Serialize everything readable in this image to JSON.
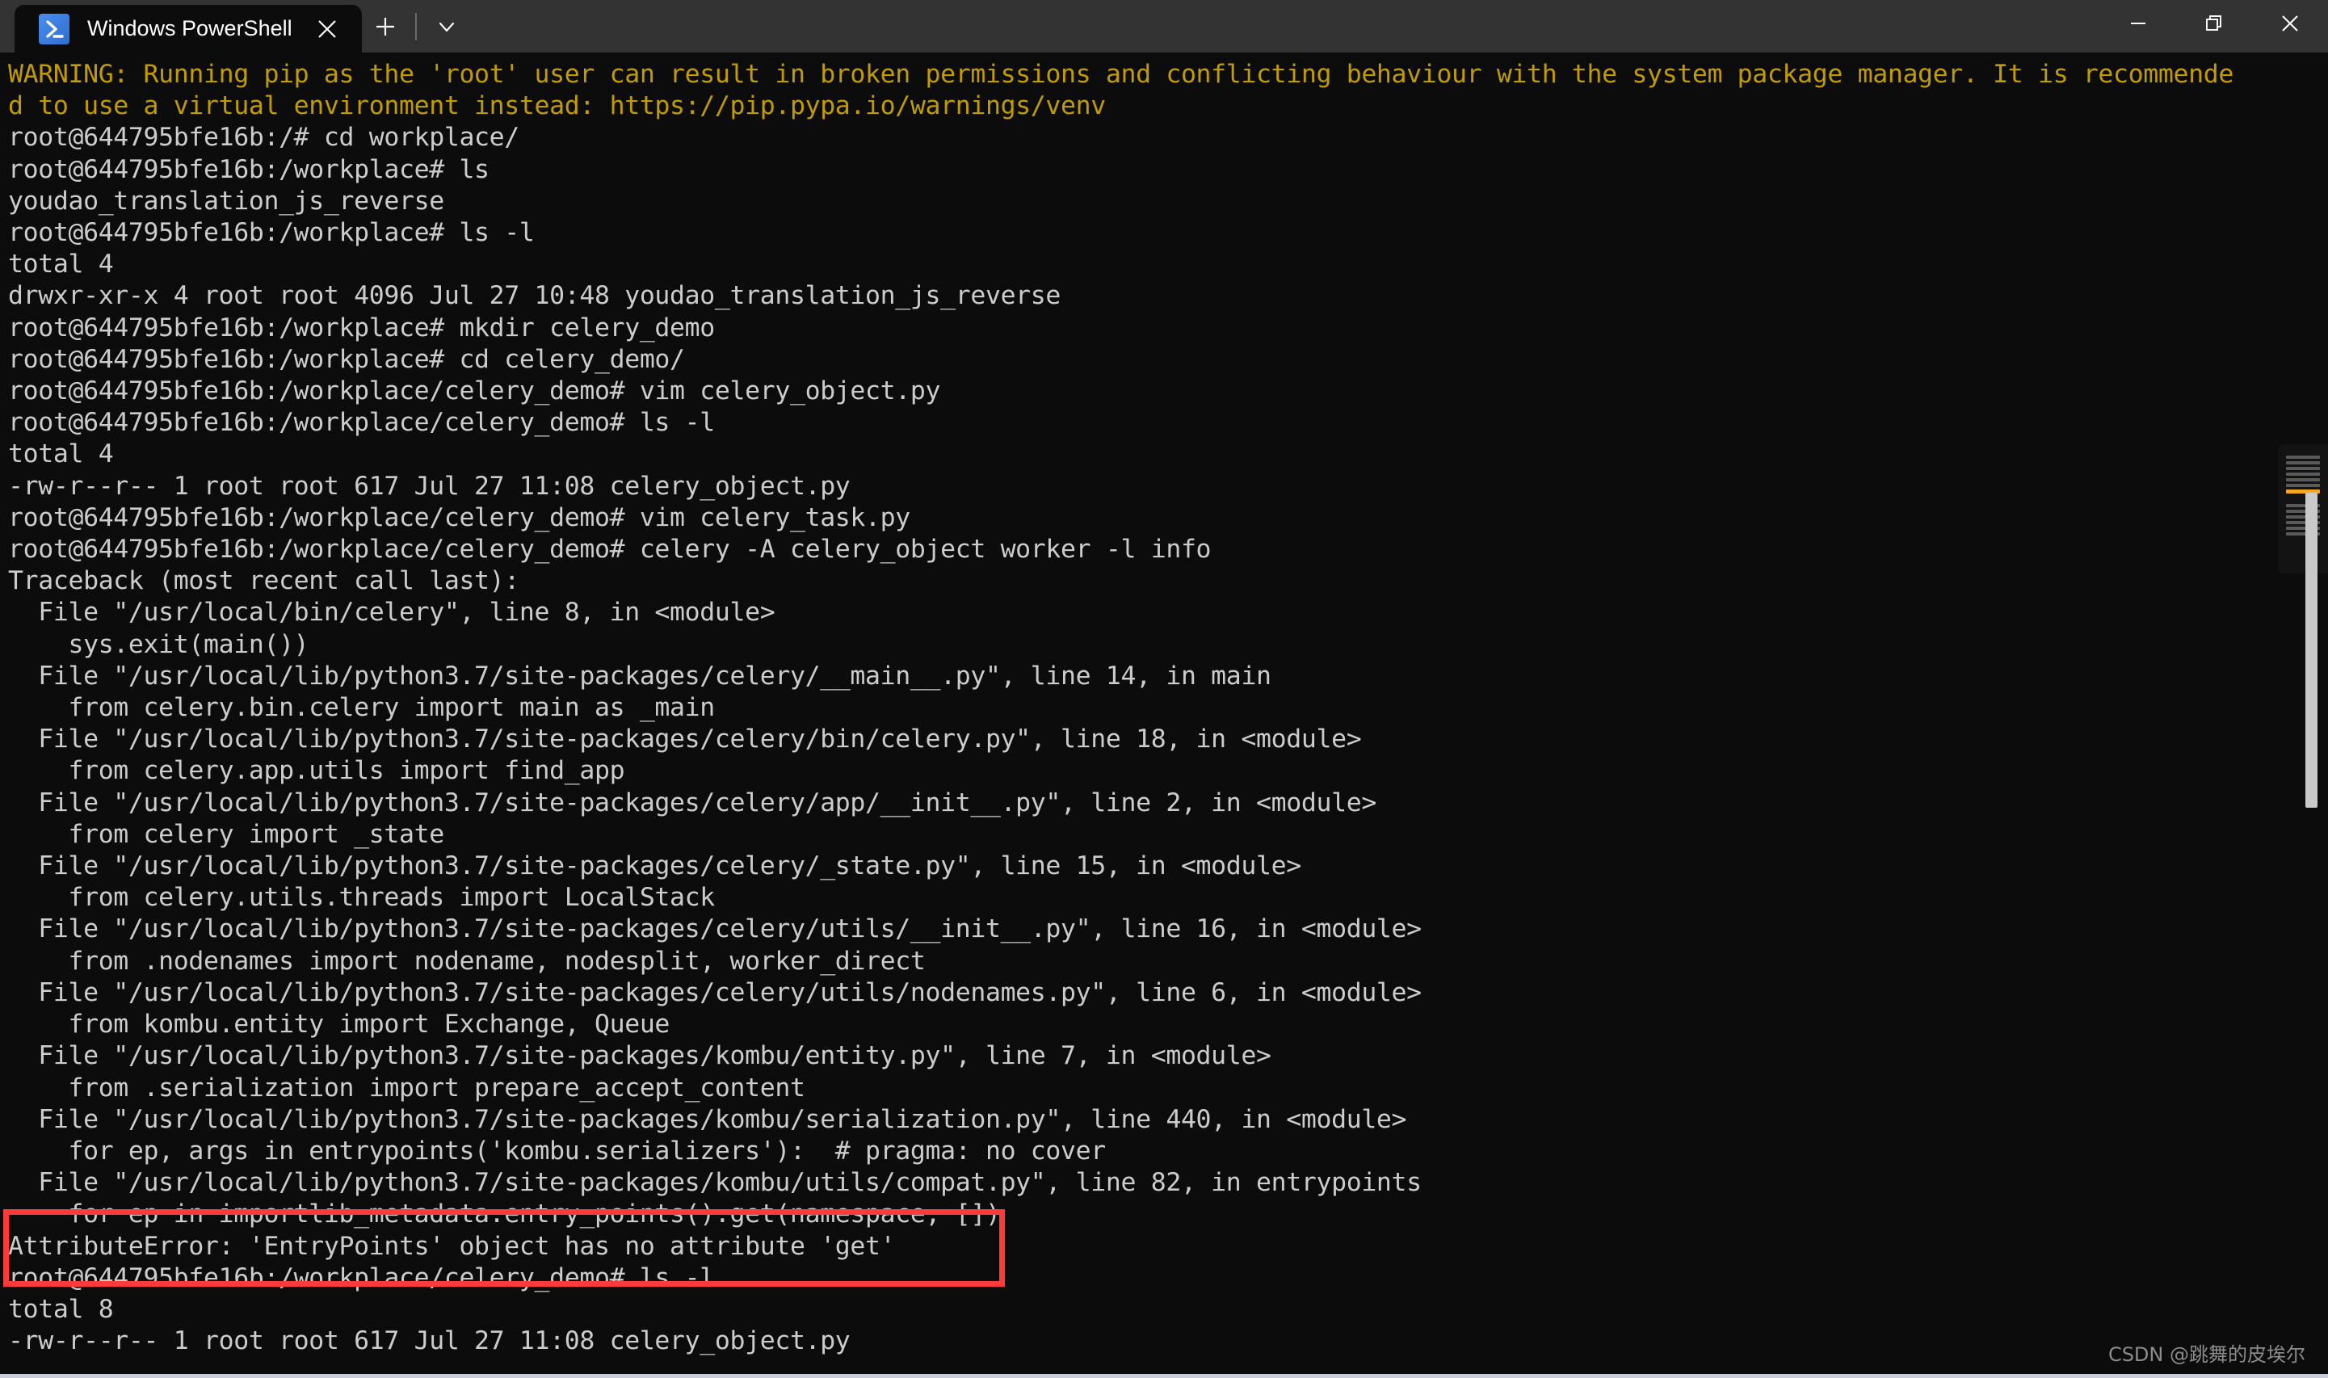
{
  "window": {
    "app_title": "Windows PowerShell",
    "tab_icon": "powershell-icon",
    "close_tab_icon": "close-icon",
    "new_tab_icon": "plus-icon",
    "tab_dropdown_icon": "chevron-down-icon",
    "minimize_icon": "minimize-icon",
    "maximize_icon": "restore-icon",
    "close_icon": "close-icon"
  },
  "terminal": {
    "prompt_host": "root@644795bfe16b",
    "lines": [
      {
        "text": "WARNING: Running pip as the 'root' user can result in broken permissions and conflicting behaviour with the system package manager. It is recommende",
        "style": "warn"
      },
      {
        "text": "d to use a virtual environment instead: https://pip.pypa.io/warnings/venv",
        "style": "warn"
      },
      {
        "text": "root@644795bfe16b:/# cd workplace/",
        "style": "normal"
      },
      {
        "text": "root@644795bfe16b:/workplace# ls",
        "style": "normal"
      },
      {
        "text": "youdao_translation_js_reverse",
        "style": "normal"
      },
      {
        "text": "root@644795bfe16b:/workplace# ls -l",
        "style": "normal"
      },
      {
        "text": "total 4",
        "style": "normal"
      },
      {
        "text": "drwxr-xr-x 4 root root 4096 Jul 27 10:48 youdao_translation_js_reverse",
        "style": "normal"
      },
      {
        "text": "root@644795bfe16b:/workplace# mkdir celery_demo",
        "style": "normal"
      },
      {
        "text": "root@644795bfe16b:/workplace# cd celery_demo/",
        "style": "normal"
      },
      {
        "text": "root@644795bfe16b:/workplace/celery_demo# vim celery_object.py",
        "style": "normal"
      },
      {
        "text": "root@644795bfe16b:/workplace/celery_demo# ls -l",
        "style": "normal"
      },
      {
        "text": "total 4",
        "style": "normal"
      },
      {
        "text": "-rw-r--r-- 1 root root 617 Jul 27 11:08 celery_object.py",
        "style": "normal"
      },
      {
        "text": "root@644795bfe16b:/workplace/celery_demo# vim celery_task.py",
        "style": "normal"
      },
      {
        "text": "root@644795bfe16b:/workplace/celery_demo# celery -A celery_object worker -l info",
        "style": "normal"
      },
      {
        "text": "Traceback (most recent call last):",
        "style": "normal"
      },
      {
        "text": "  File \"/usr/local/bin/celery\", line 8, in <module>",
        "style": "normal"
      },
      {
        "text": "    sys.exit(main())",
        "style": "normal"
      },
      {
        "text": "  File \"/usr/local/lib/python3.7/site-packages/celery/__main__.py\", line 14, in main",
        "style": "normal"
      },
      {
        "text": "    from celery.bin.celery import main as _main",
        "style": "normal"
      },
      {
        "text": "  File \"/usr/local/lib/python3.7/site-packages/celery/bin/celery.py\", line 18, in <module>",
        "style": "normal"
      },
      {
        "text": "    from celery.app.utils import find_app",
        "style": "normal"
      },
      {
        "text": "  File \"/usr/local/lib/python3.7/site-packages/celery/app/__init__.py\", line 2, in <module>",
        "style": "normal"
      },
      {
        "text": "    from celery import _state",
        "style": "normal"
      },
      {
        "text": "  File \"/usr/local/lib/python3.7/site-packages/celery/_state.py\", line 15, in <module>",
        "style": "normal"
      },
      {
        "text": "    from celery.utils.threads import LocalStack",
        "style": "normal"
      },
      {
        "text": "  File \"/usr/local/lib/python3.7/site-packages/celery/utils/__init__.py\", line 16, in <module>",
        "style": "normal"
      },
      {
        "text": "    from .nodenames import nodename, nodesplit, worker_direct",
        "style": "normal"
      },
      {
        "text": "  File \"/usr/local/lib/python3.7/site-packages/celery/utils/nodenames.py\", line 6, in <module>",
        "style": "normal"
      },
      {
        "text": "    from kombu.entity import Exchange, Queue",
        "style": "normal"
      },
      {
        "text": "  File \"/usr/local/lib/python3.7/site-packages/kombu/entity.py\", line 7, in <module>",
        "style": "normal"
      },
      {
        "text": "    from .serialization import prepare_accept_content",
        "style": "normal"
      },
      {
        "text": "  File \"/usr/local/lib/python3.7/site-packages/kombu/serialization.py\", line 440, in <module>",
        "style": "normal"
      },
      {
        "text": "    for ep, args in entrypoints('kombu.serializers'):  # pragma: no cover",
        "style": "normal"
      },
      {
        "text": "  File \"/usr/local/lib/python3.7/site-packages/kombu/utils/compat.py\", line 82, in entrypoints",
        "style": "normal"
      },
      {
        "text": "    for ep in importlib_metadata.entry_points().get(namespace, [])",
        "style": "normal"
      },
      {
        "text": "AttributeError: 'EntryPoints' object has no attribute 'get'",
        "style": "normal"
      },
      {
        "text": "root@644795bfe16b:/workplace/celery_demo# ls -l",
        "style": "normal"
      },
      {
        "text": "total 8",
        "style": "normal"
      },
      {
        "text": "-rw-r--r-- 1 root root 617 Jul 27 11:08 celery_object.py",
        "style": "normal"
      }
    ]
  },
  "annotation": {
    "highlight_color": "#fd3b3b",
    "highlighted_text": "AttributeError: 'EntryPoints' object has no attribute 'get'"
  },
  "watermark": {
    "text": "CSDN @跳舞的皮埃尔"
  }
}
